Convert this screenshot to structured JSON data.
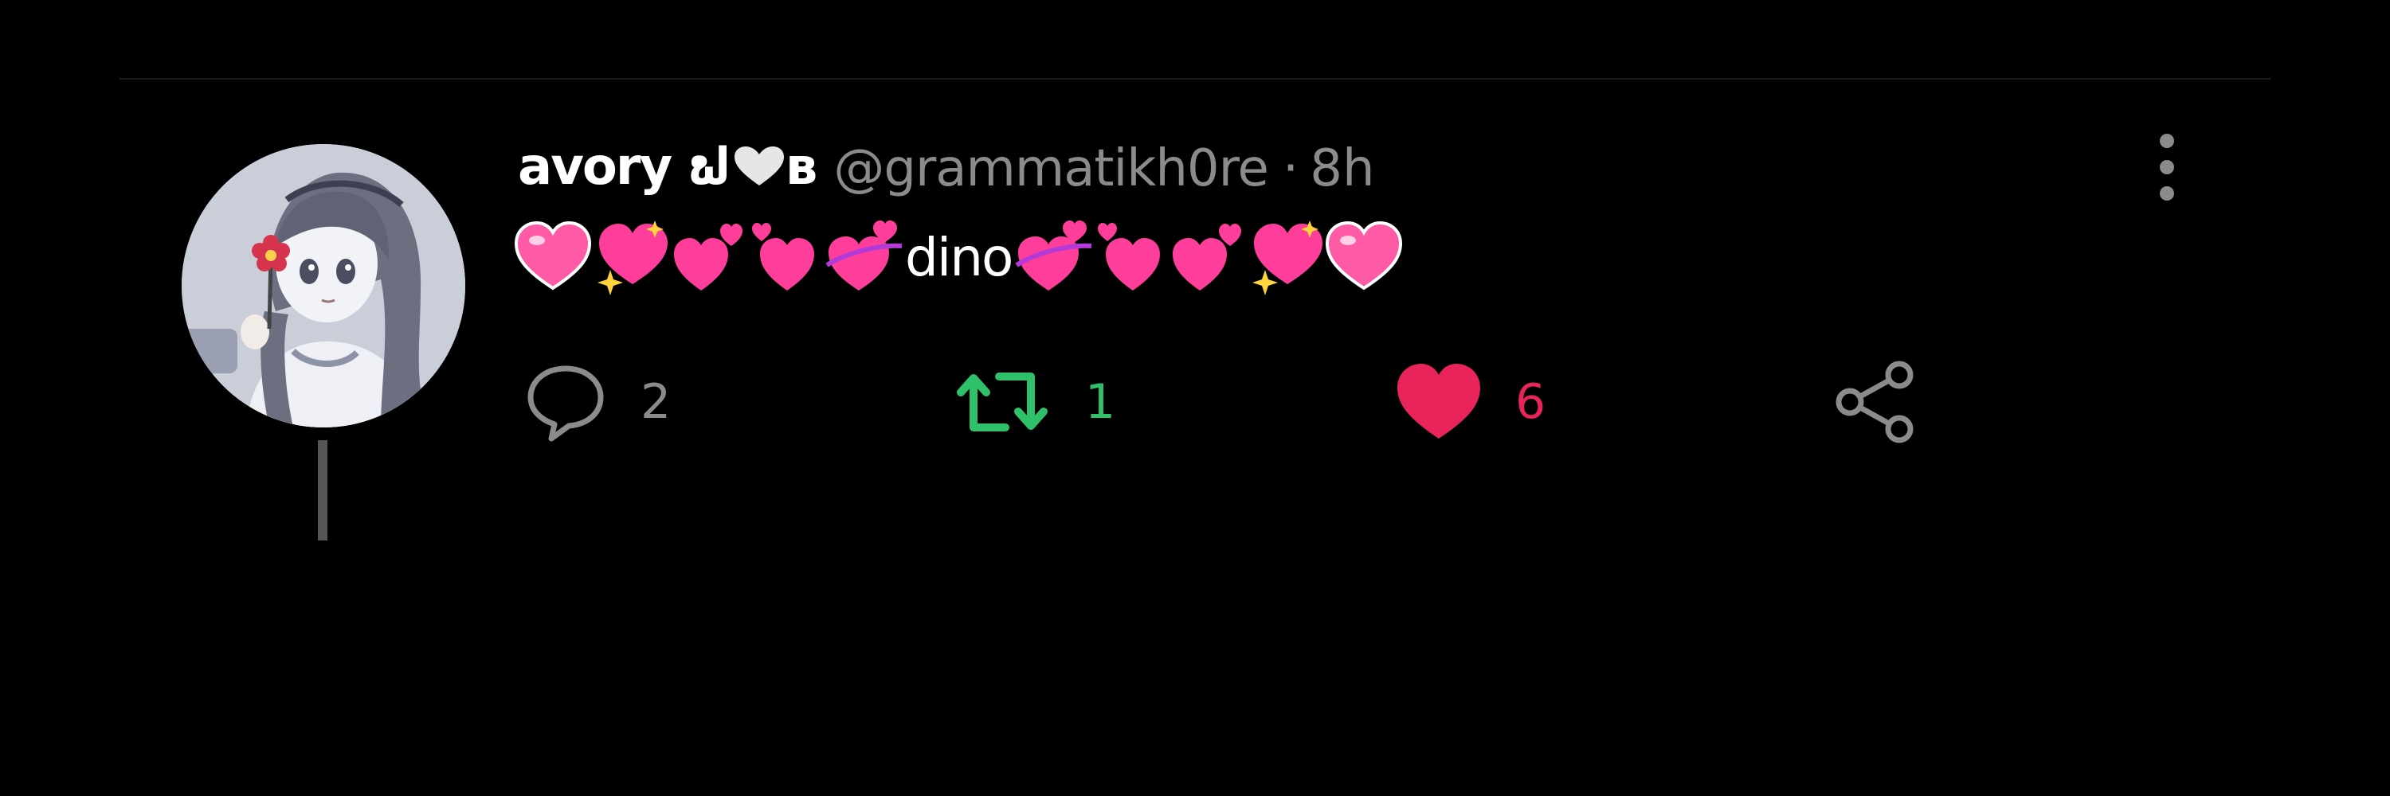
{
  "tweet": {
    "display_name": "avory ຟ",
    "display_name_suffix": "ʙ",
    "handle": "@grammatikh0re",
    "separator": "·",
    "time_ago": "8h",
    "body_text": "dino",
    "avatar_icon": "anime-girl-avatar",
    "name_icon": "gray-heart-icon",
    "body_emoji": [
      "pink-heart",
      "sparkling-heart",
      "two-hearts",
      "two-hearts",
      "revolving-hearts",
      "revolving-hearts",
      "two-hearts",
      "two-hearts",
      "sparkling-heart",
      "pink-heart"
    ]
  },
  "actions": {
    "reply": {
      "icon": "speech-bubble-icon",
      "count": "2",
      "color": "#8b8b8b"
    },
    "repost": {
      "icon": "repost-arrows-icon",
      "count": "1",
      "color": "#2ec16a"
    },
    "like": {
      "icon": "filled-heart-icon",
      "count": "6",
      "color": "#e8245a"
    },
    "share": {
      "icon": "share-nodes-icon",
      "color": "#8b8b8b"
    }
  },
  "more_menu": {
    "icon": "more-vertical-icon"
  },
  "colors": {
    "background": "#000000",
    "primary_text": "#ffffff",
    "secondary_text": "#8b8b8b",
    "repost_active": "#2ec16a",
    "like_active": "#e8245a",
    "emoji_pink": "#ff4fa3"
  }
}
